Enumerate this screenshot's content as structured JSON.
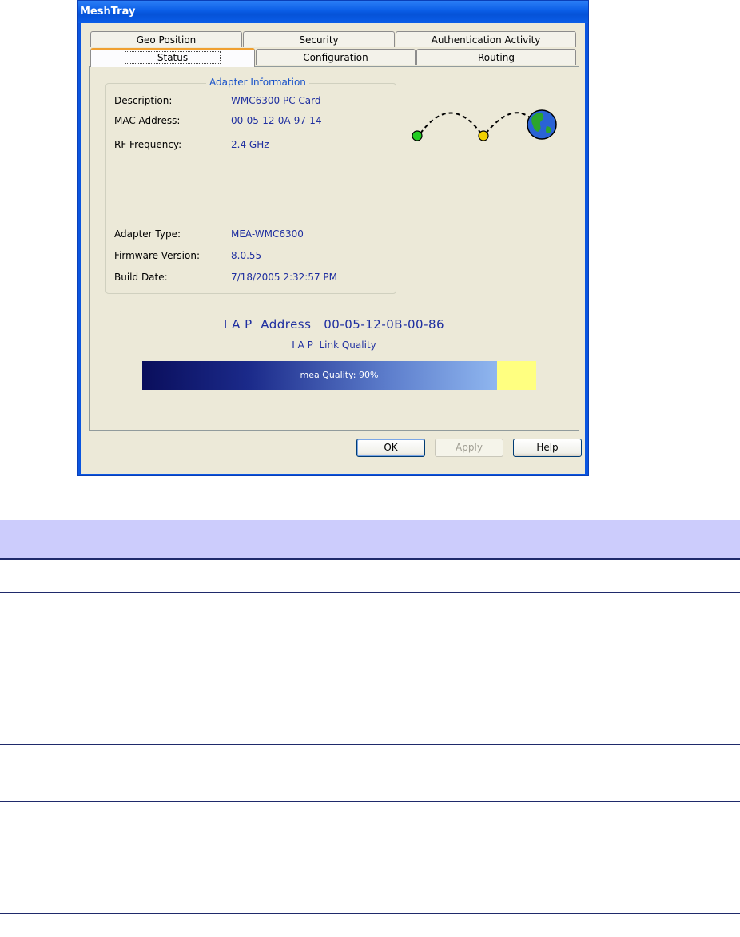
{
  "window": {
    "title": "MeshTray"
  },
  "tabs": {
    "row1": [
      "Geo Position",
      "Security",
      "Authentication Activity"
    ],
    "row2": [
      "Status",
      "Configuration",
      "Routing"
    ],
    "active": "Status"
  },
  "adapter": {
    "group_title": "Adapter Information",
    "rows": [
      {
        "label": "Description:",
        "value": "WMC6300 PC Card"
      },
      {
        "label": "MAC Address:",
        "value": "00-05-12-0A-97-14"
      },
      {
        "label": "RF Frequency:",
        "value": "2.4 GHz"
      },
      {
        "label": "Adapter Type:",
        "value": "MEA-WMC6300"
      },
      {
        "label": "Firmware Version:",
        "value": "8.0.55"
      },
      {
        "label": "Build Date:",
        "value": "7/18/2005 2:32:57 PM"
      }
    ]
  },
  "iap": {
    "address_label": "I A P  Address",
    "address_value": "00-05-12-0B-00-86",
    "link_quality_label": "I A P  Link Quality",
    "quality_text": "mea Quality: 90%",
    "quality_fraction": 0.9
  },
  "buttons": {
    "ok": "OK",
    "apply": "Apply",
    "help": "Help"
  },
  "colors": {
    "titlebar": "#0a5de6",
    "quality_start": "#0a0e5c",
    "quality_end": "#8fb6ef",
    "quality_remaining": "#ffff80",
    "table_header": "#ccccfc"
  },
  "icons": [
    "node-green-icon",
    "node-yellow-icon",
    "globe-icon"
  ]
}
